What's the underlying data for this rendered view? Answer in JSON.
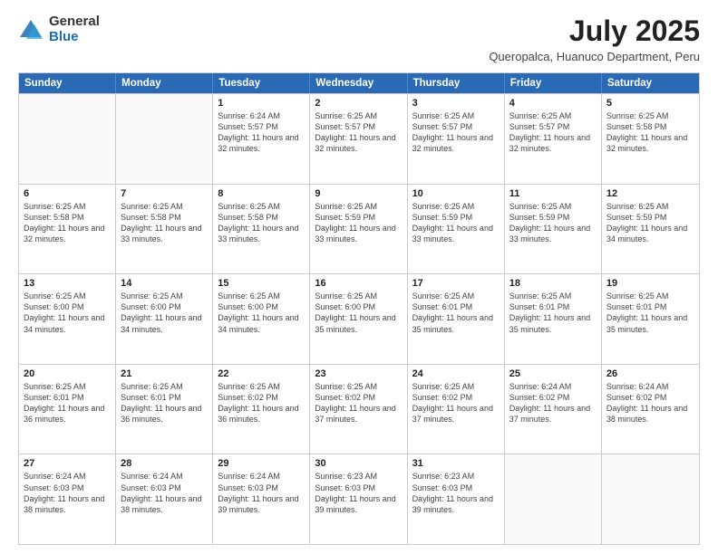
{
  "header": {
    "logo_general": "General",
    "logo_blue": "Blue",
    "title": "July 2025",
    "subtitle": "Queropalca, Huanuco Department, Peru"
  },
  "calendar": {
    "days_of_week": [
      "Sunday",
      "Monday",
      "Tuesday",
      "Wednesday",
      "Thursday",
      "Friday",
      "Saturday"
    ],
    "weeks": [
      [
        {
          "day": "",
          "empty": true
        },
        {
          "day": "",
          "empty": true
        },
        {
          "day": "1",
          "sunrise": "6:24 AM",
          "sunset": "5:57 PM",
          "daylight": "11 hours and 32 minutes."
        },
        {
          "day": "2",
          "sunrise": "6:25 AM",
          "sunset": "5:57 PM",
          "daylight": "11 hours and 32 minutes."
        },
        {
          "day": "3",
          "sunrise": "6:25 AM",
          "sunset": "5:57 PM",
          "daylight": "11 hours and 32 minutes."
        },
        {
          "day": "4",
          "sunrise": "6:25 AM",
          "sunset": "5:57 PM",
          "daylight": "11 hours and 32 minutes."
        },
        {
          "day": "5",
          "sunrise": "6:25 AM",
          "sunset": "5:58 PM",
          "daylight": "11 hours and 32 minutes."
        }
      ],
      [
        {
          "day": "6",
          "sunrise": "6:25 AM",
          "sunset": "5:58 PM",
          "daylight": "11 hours and 32 minutes."
        },
        {
          "day": "7",
          "sunrise": "6:25 AM",
          "sunset": "5:58 PM",
          "daylight": "11 hours and 33 minutes."
        },
        {
          "day": "8",
          "sunrise": "6:25 AM",
          "sunset": "5:58 PM",
          "daylight": "11 hours and 33 minutes."
        },
        {
          "day": "9",
          "sunrise": "6:25 AM",
          "sunset": "5:59 PM",
          "daylight": "11 hours and 33 minutes."
        },
        {
          "day": "10",
          "sunrise": "6:25 AM",
          "sunset": "5:59 PM",
          "daylight": "11 hours and 33 minutes."
        },
        {
          "day": "11",
          "sunrise": "6:25 AM",
          "sunset": "5:59 PM",
          "daylight": "11 hours and 33 minutes."
        },
        {
          "day": "12",
          "sunrise": "6:25 AM",
          "sunset": "5:59 PM",
          "daylight": "11 hours and 34 minutes."
        }
      ],
      [
        {
          "day": "13",
          "sunrise": "6:25 AM",
          "sunset": "6:00 PM",
          "daylight": "11 hours and 34 minutes."
        },
        {
          "day": "14",
          "sunrise": "6:25 AM",
          "sunset": "6:00 PM",
          "daylight": "11 hours and 34 minutes."
        },
        {
          "day": "15",
          "sunrise": "6:25 AM",
          "sunset": "6:00 PM",
          "daylight": "11 hours and 34 minutes."
        },
        {
          "day": "16",
          "sunrise": "6:25 AM",
          "sunset": "6:00 PM",
          "daylight": "11 hours and 35 minutes."
        },
        {
          "day": "17",
          "sunrise": "6:25 AM",
          "sunset": "6:01 PM",
          "daylight": "11 hours and 35 minutes."
        },
        {
          "day": "18",
          "sunrise": "6:25 AM",
          "sunset": "6:01 PM",
          "daylight": "11 hours and 35 minutes."
        },
        {
          "day": "19",
          "sunrise": "6:25 AM",
          "sunset": "6:01 PM",
          "daylight": "11 hours and 35 minutes."
        }
      ],
      [
        {
          "day": "20",
          "sunrise": "6:25 AM",
          "sunset": "6:01 PM",
          "daylight": "11 hours and 36 minutes."
        },
        {
          "day": "21",
          "sunrise": "6:25 AM",
          "sunset": "6:01 PM",
          "daylight": "11 hours and 36 minutes."
        },
        {
          "day": "22",
          "sunrise": "6:25 AM",
          "sunset": "6:02 PM",
          "daylight": "11 hours and 36 minutes."
        },
        {
          "day": "23",
          "sunrise": "6:25 AM",
          "sunset": "6:02 PM",
          "daylight": "11 hours and 37 minutes."
        },
        {
          "day": "24",
          "sunrise": "6:25 AM",
          "sunset": "6:02 PM",
          "daylight": "11 hours and 37 minutes."
        },
        {
          "day": "25",
          "sunrise": "6:24 AM",
          "sunset": "6:02 PM",
          "daylight": "11 hours and 37 minutes."
        },
        {
          "day": "26",
          "sunrise": "6:24 AM",
          "sunset": "6:02 PM",
          "daylight": "11 hours and 38 minutes."
        }
      ],
      [
        {
          "day": "27",
          "sunrise": "6:24 AM",
          "sunset": "6:03 PM",
          "daylight": "11 hours and 38 minutes."
        },
        {
          "day": "28",
          "sunrise": "6:24 AM",
          "sunset": "6:03 PM",
          "daylight": "11 hours and 38 minutes."
        },
        {
          "day": "29",
          "sunrise": "6:24 AM",
          "sunset": "6:03 PM",
          "daylight": "11 hours and 39 minutes."
        },
        {
          "day": "30",
          "sunrise": "6:23 AM",
          "sunset": "6:03 PM",
          "daylight": "11 hours and 39 minutes."
        },
        {
          "day": "31",
          "sunrise": "6:23 AM",
          "sunset": "6:03 PM",
          "daylight": "11 hours and 39 minutes."
        },
        {
          "day": "",
          "empty": true
        },
        {
          "day": "",
          "empty": true
        }
      ]
    ]
  }
}
